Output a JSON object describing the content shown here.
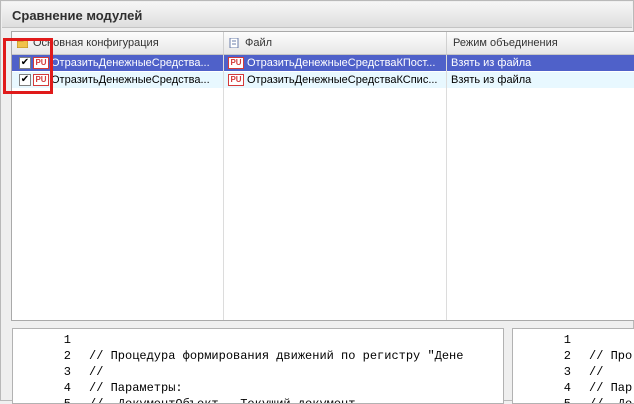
{
  "window": {
    "title": "Сравнение модулей"
  },
  "table": {
    "columns": [
      {
        "label": "Основная конфигурация",
        "icon": "configuration-icon"
      },
      {
        "label": "Файл",
        "icon": "file-icon"
      },
      {
        "label": "Режим объединения"
      }
    ],
    "rows": [
      {
        "checked": "✔",
        "module_badge": "PU",
        "main": "ОтразитьДенежныеСредства...",
        "file": "ОтразитьДенежныеСредстваКПост...",
        "mode": "Взять из файла"
      },
      {
        "checked": "✔",
        "module_badge": "PU",
        "main": "ОтразитьДенежныеСредства...",
        "file": "ОтразитьДенежныеСредстваКСпис...",
        "mode": "Взять из файла"
      }
    ]
  },
  "code_left": {
    "lines": [
      {
        "n": "1",
        "text": ""
      },
      {
        "n": "2",
        "text": "// Процедура формирования движений по регистру \"Дене"
      },
      {
        "n": "3",
        "text": "//"
      },
      {
        "n": "4",
        "text": "// Параметры:"
      },
      {
        "n": "5",
        "text": "//  ДокументОбъект - Текущий документ"
      }
    ]
  },
  "code_right": {
    "lines": [
      {
        "n": "1",
        "text": ""
      },
      {
        "n": "2",
        "text": "// Про"
      },
      {
        "n": "3",
        "text": "//"
      },
      {
        "n": "4",
        "text": "// Пар"
      },
      {
        "n": "5",
        "text": "//  До"
      }
    ]
  },
  "colors": {
    "selection": "#4f61c9",
    "row_alt": "#e8f8ff",
    "highlight": "#e01a1a",
    "module_icon": "#d43a3a"
  }
}
